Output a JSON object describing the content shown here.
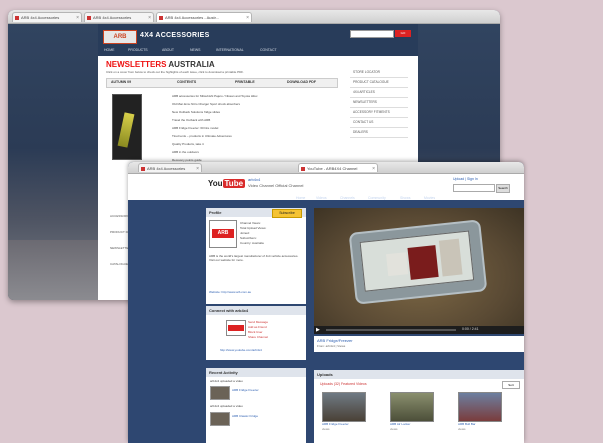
{
  "back_window": {
    "tabs": [
      "ARB 4x4 Accessories",
      "ARB 4x4 Accessories",
      "ARB 4x4 Accessories - Austr..."
    ],
    "brand": "4X4 ACCESSORIES",
    "logo": "ARB",
    "nav": [
      "HOME",
      "PRODUCTS",
      "ABOUT",
      "NEWS",
      "INTERNATIONAL",
      "CONTACT"
    ],
    "search_button": "GO",
    "title_red": "NEWSLETTERS",
    "title_dark": "AUSTRALIA",
    "intro": "Click on a cover from below to check out the highlights of each issue, click to download a printable PDF.",
    "columns": [
      "AUTUMN 09",
      "CONTENTS",
      "PRINTABLE",
      "DOWNLOAD PDF"
    ],
    "bullets": [
      "ARB accessories for Mitsubishi Pajero / Nissan and Toyota Hilux",
      "Old Man Emu Nitro Charger Sport shock absorbers",
      "New Outback Solutions fridge slides",
      "Travel the Outback with ARB",
      "ARB Fridge Freezer: 60 litre model",
      "Tired tents – products in Ultimate Adventures",
      "Quality Products, take it",
      "ARB in the outdoors",
      "Recovery points guide"
    ],
    "side_links": [
      "STORE LOCATOR",
      "PRODUCT CATALOGUE",
      "4X4 ARTICLES",
      "NEWSLETTERS",
      "ACCESSORY FITMENTS",
      "CONTACT US",
      "DEALERS"
    ],
    "left_links": [
      "ACCESSORY FITMENTS",
      "PRODUCT RANGE",
      "NEWSLETTERS",
      "CATALOGUE"
    ]
  },
  "front_window": {
    "tabs": [
      "ARB 4x4 Accessories",
      "YouTube - ARB4X4 Channel"
    ],
    "logo_you": "You",
    "logo_tube": "Tube",
    "username": "arb4x4",
    "channel_subtitle": "Video Channel Official Channel",
    "top_right": "Upload | Sign In",
    "search_button": "Search",
    "subnav": [
      "Home",
      "Videos",
      "Channels",
      "Community",
      "Shows",
      "Movies"
    ],
    "about": {
      "heading": "Profile",
      "subscribe": "Subscribe",
      "logo": "ARB",
      "meta": [
        "Channel Views:",
        "Total Upload Views:",
        "Joined:",
        "Subscribers:",
        "Country: Australia"
      ],
      "desc": "ARB is the world's largest manufacturer of 4x4 vehicle accessories. Visit our website for more.",
      "site": "Website: http://www.arb.com.au"
    },
    "links_box": {
      "heading": "Connect with arb4x4",
      "links": [
        "Send Message",
        "Add as Friend",
        "Block User",
        "Share Channel"
      ],
      "url": "http://www.youtube.com/arb4x4"
    },
    "activity": {
      "heading": "Recent Activity",
      "items": [
        "arb4x4 uploaded a video",
        "ARB Fridge Freezer",
        "arb4x4 uploaded a video",
        "ARB Classic Fridge"
      ]
    },
    "video": {
      "title": "ARB Fridge/Freezer",
      "sub": "From: arb4x4 | Views",
      "time": "0:00 / 2:41"
    },
    "uploads": {
      "heading": "Uploads",
      "title": "Uploads (32)  Featured Videos",
      "sort": "Sort",
      "items": [
        {
          "title": "ARB Fridge Freezer",
          "views": "views"
        },
        {
          "title": "ARB Air Locker",
          "views": "views"
        },
        {
          "title": "ARB Bull Bar",
          "views": "views"
        }
      ]
    }
  }
}
